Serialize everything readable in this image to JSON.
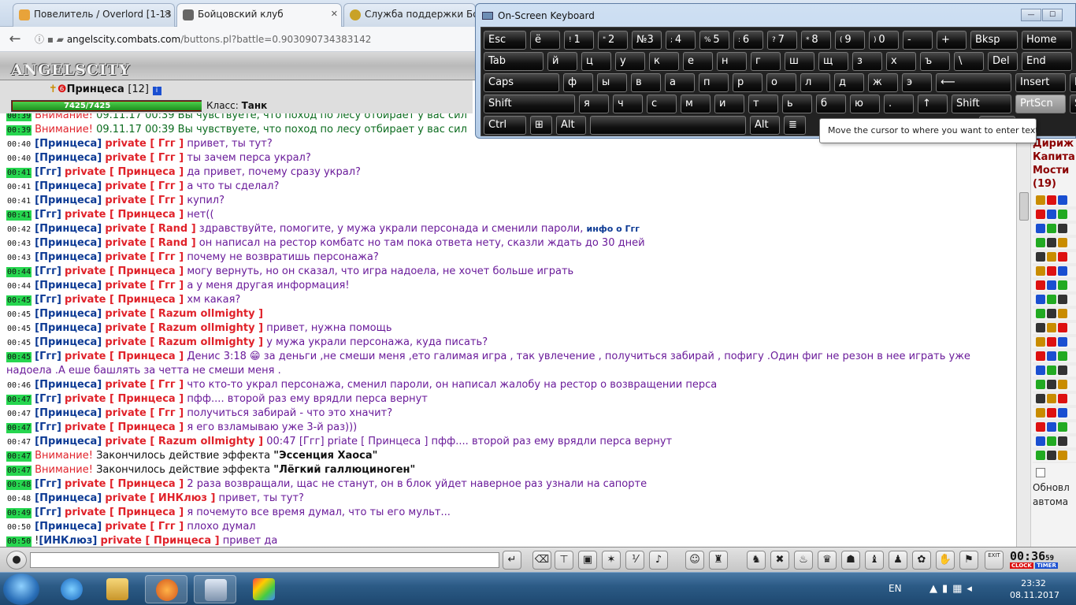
{
  "browser": {
    "tabs": [
      {
        "title": "Повелитель / Overlord [1-13",
        "active": false
      },
      {
        "title": "Бойцовский клуб",
        "active": true
      },
      {
        "title": "Служба поддержки Бойц",
        "active": false
      }
    ],
    "url_domain": "angelscity.combats.com",
    "url_path": "/buttons.pl?battle=0.903090734383142"
  },
  "game": {
    "logo": "ANGELSCITY",
    "player_name": "Принцеса",
    "player_level": "[12]",
    "hp": "7425/7425",
    "hp_fraction": 1.0,
    "class_label": "Класс:",
    "class_value": "Танк"
  },
  "chat": [
    {
      "t": "00:39",
      "hl": true,
      "warn": "Внимание!",
      "sys": "09.11.17 00:39 Вы чувствуете, что поход по лесу отбирает у вас сил"
    },
    {
      "t": "00:39",
      "hl": true,
      "warn": "Внимание!",
      "sys": "09.11.17 00:39 Вы чувствуете, что поход по лесу отбирает у вас сил"
    },
    {
      "t": "00:40",
      "hl": false,
      "nick": "Принцеса",
      "to": "Ггг",
      "msg": "привет, ты тут?"
    },
    {
      "t": "00:40",
      "hl": false,
      "nick": "Принцеса",
      "to": "Ггг",
      "msg": "ты зачем перса украл?"
    },
    {
      "t": "00:41",
      "hl": true,
      "nick": "Ггг",
      "to": "Принцеса",
      "msg": "да привет, почему сразу украл?"
    },
    {
      "t": "00:41",
      "hl": false,
      "nick": "Принцеса",
      "to": "Ггг",
      "msg": "а что ты сделал?"
    },
    {
      "t": "00:41",
      "hl": false,
      "nick": "Принцеса",
      "to": "Ггг",
      "msg": "купил?"
    },
    {
      "t": "00:41",
      "hl": true,
      "nick": "Ггг",
      "to": "Принцеса",
      "msg": "нет(("
    },
    {
      "t": "00:42",
      "hl": false,
      "nick": "Принцеса",
      "to": "Rand",
      "msg": "здравствуйте, помогите, у мужа украли персонада и сменили пароли,",
      "extra": "инфо о Ггг"
    },
    {
      "t": "00:43",
      "hl": false,
      "nick": "Принцеса",
      "to": "Rand",
      "msg": "он написал на рестор комбатс но там пока ответа нету, сказли ждать до 30 дней"
    },
    {
      "t": "00:43",
      "hl": false,
      "nick": "Принцеса",
      "to": "Ггг",
      "msg": "почему не возвратишь персонажа?"
    },
    {
      "t": "00:44",
      "hl": true,
      "nick": "Ггг",
      "to": "Принцеса",
      "msg": "могу вернуть, но он сказал, что игра надоела, не хочет больше играть"
    },
    {
      "t": "00:44",
      "hl": false,
      "nick": "Принцеса",
      "to": "Ггг",
      "msg": "а у меня другая информация!"
    },
    {
      "t": "00:45",
      "hl": true,
      "nick": "Ггг",
      "to": "Принцеса",
      "msg": "хм какая?"
    },
    {
      "t": "00:45",
      "hl": false,
      "nick": "Принцеса",
      "to": "Razum ollmighty",
      "msg": ""
    },
    {
      "t": "00:45",
      "hl": false,
      "nick": "Принцеса",
      "to": "Razum ollmighty",
      "msg": "привет, нужна помощь"
    },
    {
      "t": "00:45",
      "hl": false,
      "nick": "Принцеса",
      "to": "Razum ollmighty",
      "msg": "у мужа украли персонажа, куда писать?"
    },
    {
      "t": "00:45",
      "hl": true,
      "nick": "Ггг",
      "to": "Принцеса",
      "msg": "Денис 3:18 😁 за деньги ,не смеши меня ,ето галимая игра , так увлечение , получиться забирай , пофигу .Один фиг не резон в нее играть уже надоела .А еше башлять за четта не смеши меня .",
      "wrap": true
    },
    {
      "t": "00:46",
      "hl": false,
      "nick": "Принцеса",
      "to": "Ггг",
      "msg": "что кто-то украл персонажа, сменил пароли, он написал жалобу на рестор о возвращении перса"
    },
    {
      "t": "00:47",
      "hl": true,
      "nick": "Ггг",
      "to": "Принцеса",
      "msg": "пфф.... второй раз ему врядли перса вернут"
    },
    {
      "t": "00:47",
      "hl": false,
      "nick": "Принцеса",
      "to": "Ггг",
      "msg": "получиться забирай - что это хначит?"
    },
    {
      "t": "00:47",
      "hl": true,
      "nick": "Ггг",
      "to": "Принцеса",
      "msg": "я его взламываю уже 3-й раз)))"
    },
    {
      "t": "00:47",
      "hl": false,
      "nick": "Принцеса",
      "to": "Razum ollmighty",
      "msg": "00:47 [Ггг] priate [ Принцеса ] пфф.... второй раз ему врядли перса вернут"
    },
    {
      "t": "00:47",
      "hl": true,
      "warn": "Внимание!",
      "blk": "Закончилось действие эффекта",
      "eff": "\"Эссенция Хаоса\""
    },
    {
      "t": "00:47",
      "hl": true,
      "warn": "Внимание!",
      "blk": "Закончилось действие эффекта",
      "eff": "\"Лёгкий галлюциноген\""
    },
    {
      "t": "00:48",
      "hl": true,
      "nick": "Ггг",
      "to": "Принцеса",
      "msg": "2 раза возвращали, щас не станут, он в блок уйдет наверное раз узнали на сапорте"
    },
    {
      "t": "00:48",
      "hl": false,
      "nick": "Принцеса",
      "to": "ИНКлюз",
      "msg": "привет, ты тут?"
    },
    {
      "t": "00:49",
      "hl": true,
      "nick": "Ггг",
      "to": "Принцеса",
      "msg": "я почемуто все время думал, что ты его мульт..."
    },
    {
      "t": "00:50",
      "hl": false,
      "nick": "Принцеса",
      "to": "Ггг",
      "msg": "плохо думал"
    },
    {
      "t": "00:50",
      "hl": true,
      "pre": "!",
      "nick": "ИНКлюз",
      "to": "Принцеса",
      "msg": "привет да"
    }
  ],
  "right_panel": {
    "lines": [
      "Дириж",
      "Капита",
      "Мости",
      "(19)"
    ],
    "refresh_label": "Обновл",
    "auto_label": "автома"
  },
  "toolbar": {
    "timer": "00:36",
    "timer_sec": "59",
    "clock_label": "CLOCK",
    "timer_label": "TIMER",
    "exit_label": "EXIT"
  },
  "osk": {
    "title": "On-Screen Keyboard",
    "tooltip": "Move the cursor to where you want to enter text.",
    "rows": [
      [
        "Esc",
        "ё",
        "1",
        "2",
        "№3",
        "4",
        "5",
        "6",
        "7",
        "8",
        "9",
        "0",
        "-",
        "+",
        "Bksp",
        "Home",
        "PgUp"
      ],
      [
        "Tab",
        "й",
        "ц",
        "у",
        "к",
        "е",
        "н",
        "г",
        "ш",
        "щ",
        "з",
        "х",
        "ъ",
        "\\",
        "Del",
        "End",
        "PgDn"
      ],
      [
        "Caps",
        "ф",
        "ы",
        "в",
        "а",
        "п",
        "р",
        "о",
        "л",
        "д",
        "ж",
        "э",
        "⟵",
        "Insert",
        "Pause"
      ],
      [
        "Shift",
        "я",
        "ч",
        "с",
        "м",
        "и",
        "т",
        "ь",
        "б",
        "ю",
        ".",
        "↑",
        "Shift",
        "PrtScn",
        "ScLk"
      ],
      [
        "Ctrl",
        "⊞",
        "Alt",
        "",
        "Alt",
        "≣",
        "",
        "Справ"
      ]
    ]
  },
  "taskbar": {
    "lang": "EN",
    "time": "23:32",
    "date": "08.11.2017"
  }
}
